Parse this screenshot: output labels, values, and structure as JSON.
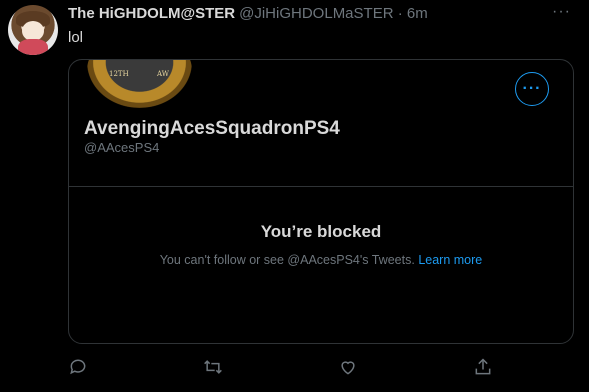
{
  "tweet": {
    "display_name": "The HiGHDOLM@STER",
    "handle_time": "@JiHiGHDOLMaSTER · 6m",
    "text": "lol"
  },
  "card": {
    "badge_text_left": "12TH",
    "badge_text_right": "AW",
    "account_name": "AvengingAcesSquadronPS4",
    "account_handle": "@AAcesPS4",
    "blocked_title": "You’re blocked",
    "blocked_message": "You can't follow or see @AAcesPS4's Tweets. ",
    "learn_more": "Learn more"
  },
  "icons": {
    "more_top": "more-horizontal-icon",
    "more_card": "more-horizontal-icon",
    "reply": "reply-icon",
    "retweet": "retweet-icon",
    "like": "heart-icon",
    "share": "share-icon"
  },
  "colors": {
    "background": "#000000",
    "accent": "#1d9bf0",
    "text": "#d9d9d9",
    "muted": "#6e767d",
    "border": "#2f3336"
  }
}
